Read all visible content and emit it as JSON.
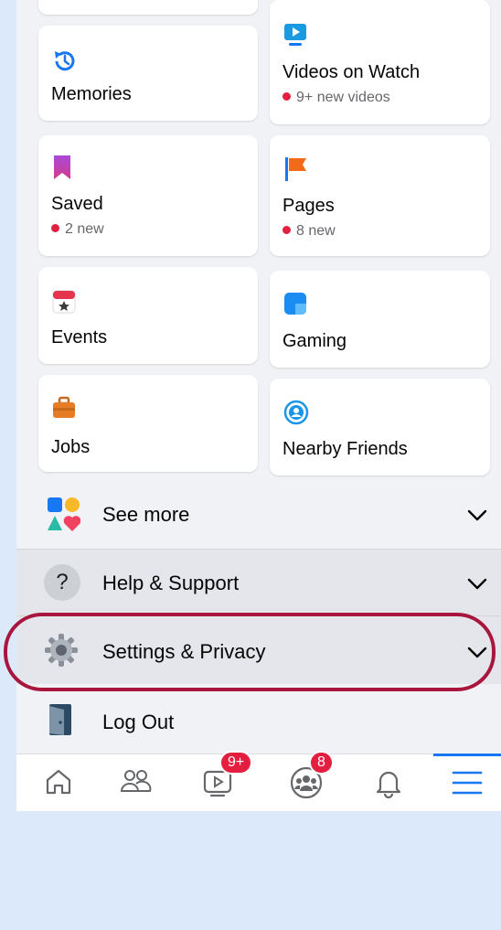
{
  "shortcuts": {
    "memories": {
      "title": "Memories"
    },
    "videos": {
      "title": "Videos on Watch",
      "sub": "9+ new videos"
    },
    "saved": {
      "title": "Saved",
      "sub": "2 new"
    },
    "pages": {
      "title": "Pages",
      "sub": "8 new"
    },
    "events": {
      "title": "Events"
    },
    "gaming": {
      "title": "Gaming"
    },
    "jobs": {
      "title": "Jobs"
    },
    "nearby": {
      "title": "Nearby Friends"
    }
  },
  "menu": {
    "see_more": "See more",
    "help": "Help & Support",
    "settings": "Settings & Privacy",
    "logout": "Log Out"
  },
  "tabbar": {
    "watch_badge": "9+",
    "groups_badge": "8"
  },
  "colors": {
    "accent": "#1877f2",
    "badge": "#e41e3f",
    "highlight": "#a8163d"
  }
}
